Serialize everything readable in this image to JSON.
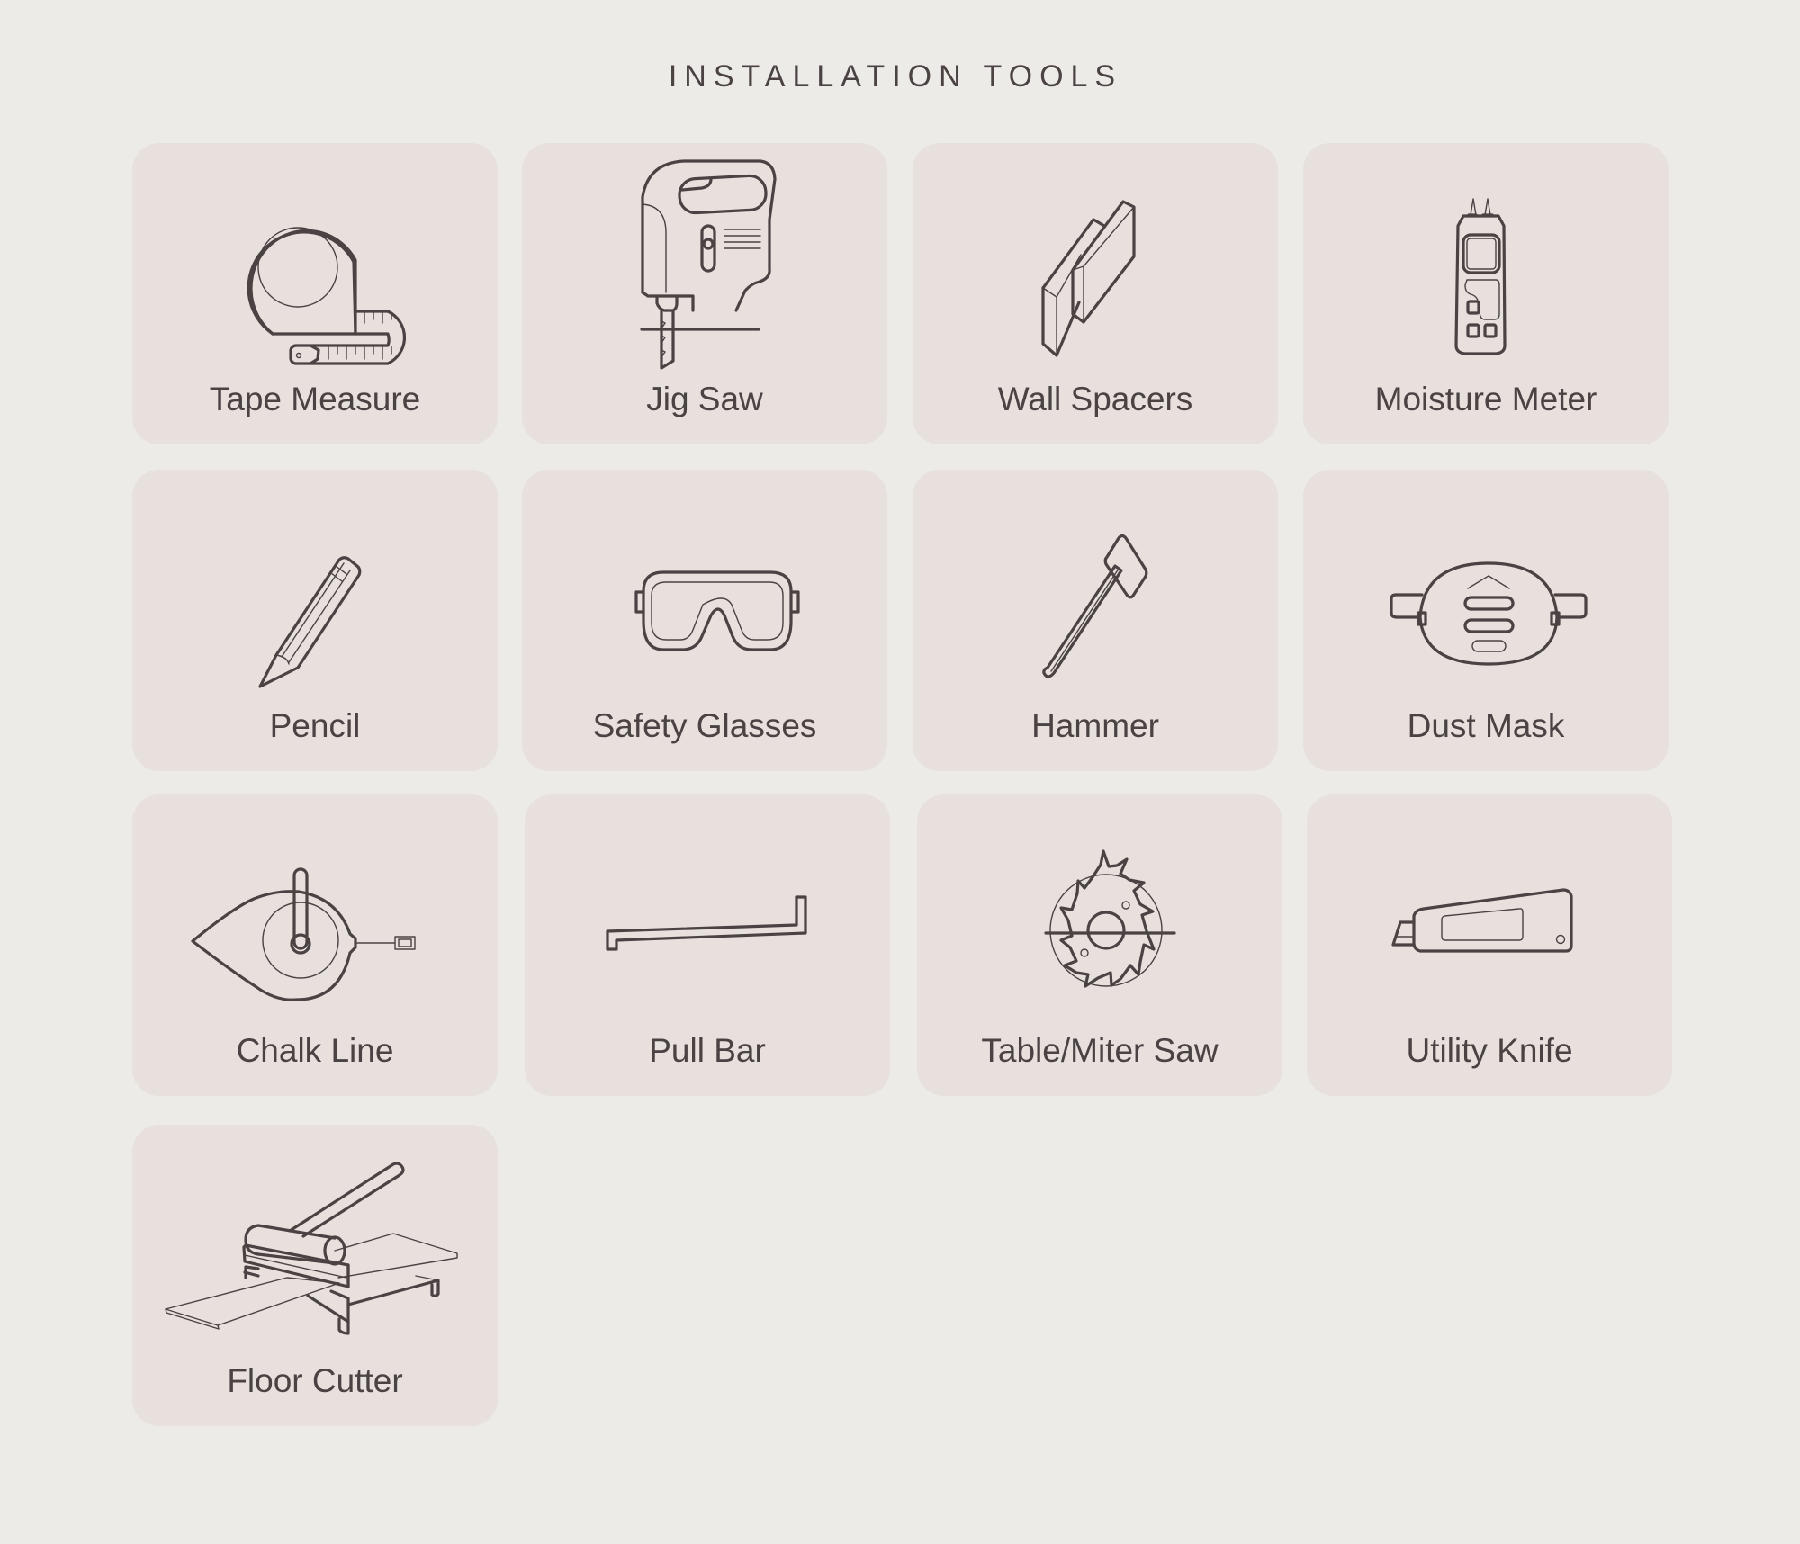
{
  "page": {
    "title": "INSTALLATION TOOLS"
  },
  "colors": {
    "background": "#edebe8",
    "card": "#e7e0dd",
    "ink": "#4a4243"
  },
  "tools": [
    {
      "label": "Tape Measure",
      "icon": "tape-measure-icon"
    },
    {
      "label": "Jig Saw",
      "icon": "jig-saw-icon"
    },
    {
      "label": "Wall Spacers",
      "icon": "wall-spacers-icon"
    },
    {
      "label": "Moisture Meter",
      "icon": "moisture-meter-icon"
    },
    {
      "label": "Pencil",
      "icon": "pencil-icon"
    },
    {
      "label": "Safety Glasses",
      "icon": "safety-glasses-icon"
    },
    {
      "label": "Hammer",
      "icon": "hammer-icon"
    },
    {
      "label": "Dust Mask",
      "icon": "dust-mask-icon"
    },
    {
      "label": "Chalk Line",
      "icon": "chalk-line-icon"
    },
    {
      "label": "Pull Bar",
      "icon": "pull-bar-icon"
    },
    {
      "label": "Table/Miter Saw",
      "icon": "table-miter-saw-icon"
    },
    {
      "label": "Utility Knife",
      "icon": "utility-knife-icon"
    },
    {
      "label": "Floor Cutter",
      "icon": "floor-cutter-icon"
    }
  ]
}
